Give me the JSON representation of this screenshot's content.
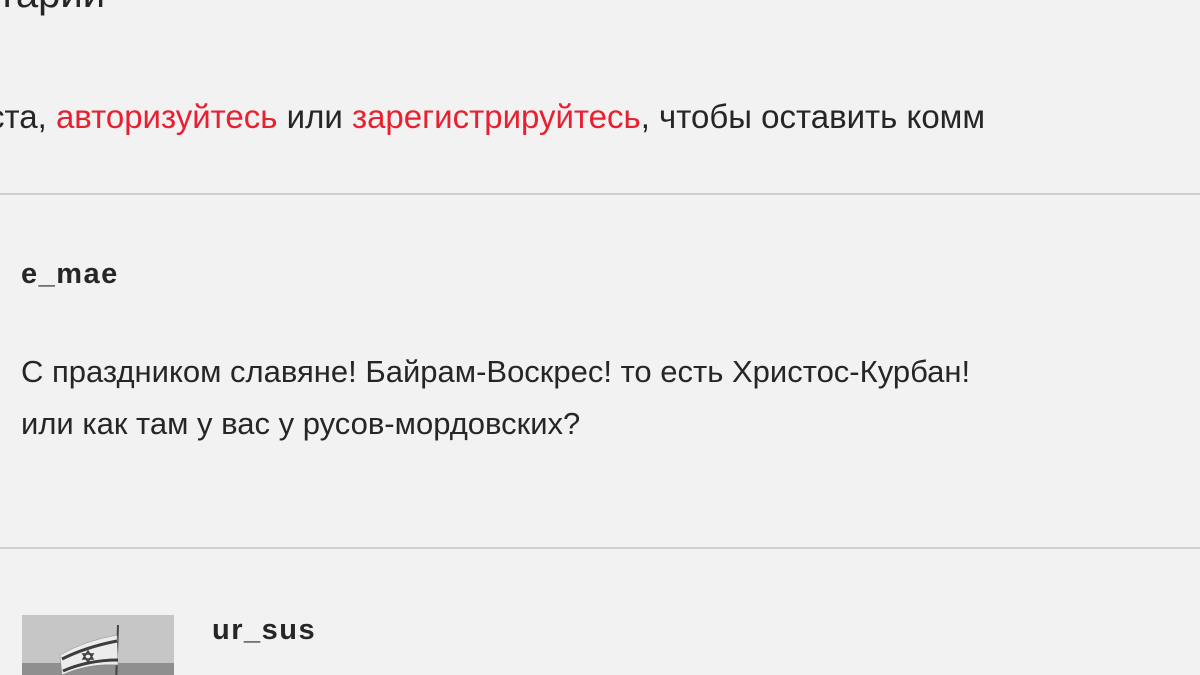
{
  "section": {
    "title": "тарии"
  },
  "login_prompt": {
    "prefix": "ста, ",
    "login_link": "авторизуйтесь",
    "middle": " или ",
    "register_link": "зарегистрируйтесь",
    "suffix": ", чтобы оставить комм"
  },
  "comments": [
    {
      "author": "e_mae",
      "lines": [
        "С праздником славяне! Байрам-Воскрес! то есть Христос-Курбан!",
        "или как там у вас у русов-мордовских?"
      ]
    },
    {
      "author": "ur_sus"
    }
  ],
  "colors": {
    "background": "#f2f2f2",
    "text": "#262626",
    "link": "#e8202f",
    "divider": "#d0d0d0"
  },
  "icons": {
    "avatar_image": "israel-flag-photo"
  }
}
